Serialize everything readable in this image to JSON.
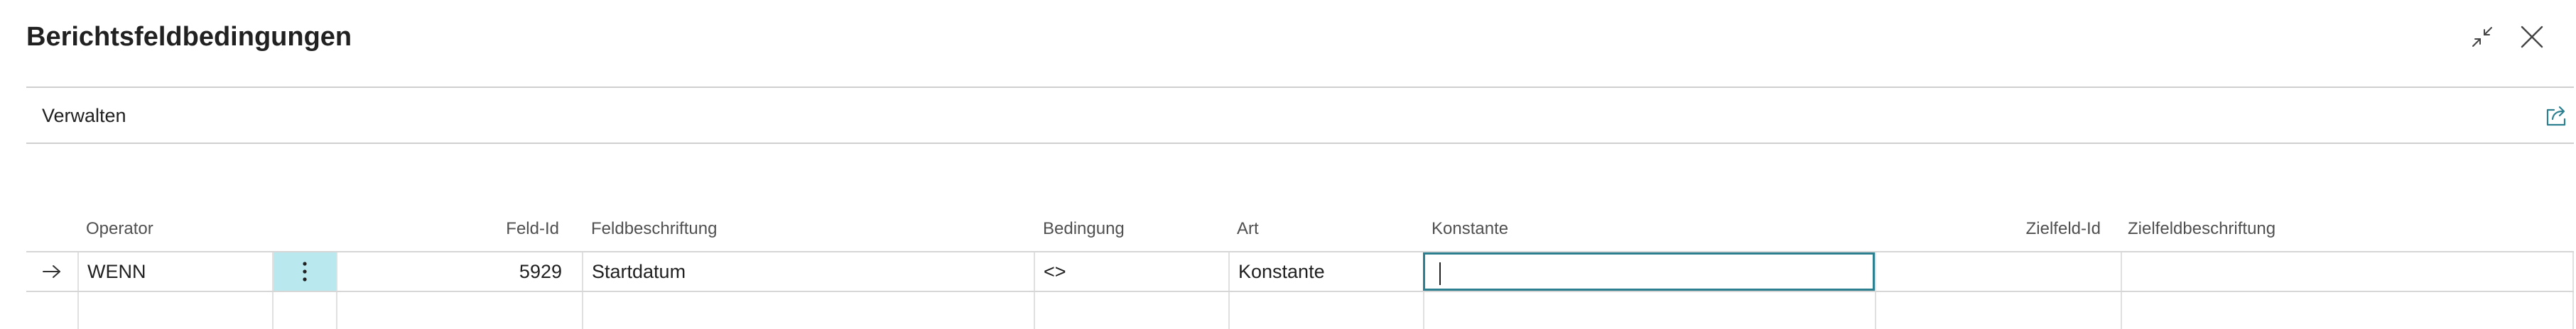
{
  "dialog": {
    "title": "Berichtsfeldbedingungen"
  },
  "actionbar": {
    "manage_label": "Verwalten"
  },
  "grid": {
    "headers": {
      "operator": "Operator",
      "field_id": "Feld-Id",
      "field_caption": "Feldbeschriftung",
      "condition": "Bedingung",
      "type": "Art",
      "constant": "Konstante",
      "target_field_id": "Zielfeld-Id",
      "target_field_caption": "Zielfeldbeschriftung"
    },
    "rows": [
      {
        "operator": "WENN",
        "field_id": "5929",
        "field_caption": "Startdatum",
        "condition": "<>",
        "type": "Konstante",
        "constant": "",
        "target_field_id": "",
        "target_field_caption": ""
      }
    ]
  },
  "colors": {
    "accent": "#2b7f8f",
    "row_action_bg": "#b9e8ee"
  },
  "icons": {
    "collapse": "collapse-icon",
    "close": "close-icon",
    "share": "share-icon",
    "current_row": "arrow-right-icon",
    "row_menu": "vertical-ellipsis-icon"
  }
}
